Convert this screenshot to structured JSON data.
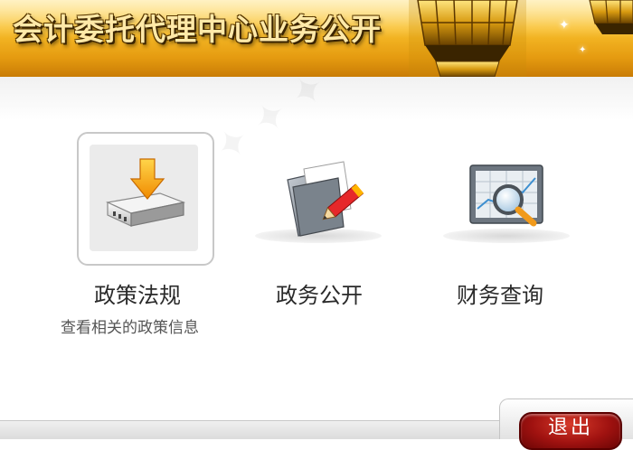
{
  "header": {
    "title": "会计委托代理中心业务公开"
  },
  "menu": {
    "items": [
      {
        "label": "政策法规",
        "description": "查看相关的政策信息",
        "icon": "download-drive-icon",
        "selected": true
      },
      {
        "label": "政务公开",
        "icon": "folder-pencil-icon",
        "selected": false
      },
      {
        "label": "财务查询",
        "icon": "chart-magnifier-icon",
        "selected": false
      }
    ]
  },
  "footer": {
    "exit_label": "退出"
  },
  "colors": {
    "header_gold": "#f9c02c",
    "exit_red": "#a01210"
  }
}
